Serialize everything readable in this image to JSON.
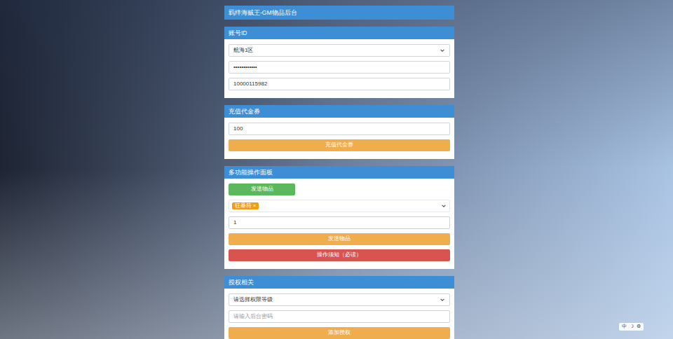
{
  "window": {
    "title": "羁绊海贼王-GM物品后台"
  },
  "sections": [
    {
      "title": "账号ID",
      "fields": [
        {
          "kind": "select",
          "text": "航海1区",
          "placeholder": false
        },
        {
          "kind": "input",
          "text": "••••••••••••",
          "placeholder": false
        },
        {
          "kind": "input",
          "text": "10000115982",
          "placeholder": false
        }
      ]
    },
    {
      "title": "充值代金券",
      "fields": [
        {
          "kind": "input",
          "text": "100",
          "placeholder": false
        },
        {
          "kind": "button",
          "text": "充值代金券",
          "color": "#f0ad4e"
        }
      ]
    },
    {
      "title": "多功能操作面板",
      "fields": [
        {
          "kind": "smallbutton",
          "text": "发送物品",
          "color": "#5cb85c"
        },
        {
          "kind": "tags",
          "tags": [
            {
              "label": "狂暴符",
              "remove": "×"
            }
          ]
        },
        {
          "kind": "input",
          "text": "1",
          "placeholder": false
        },
        {
          "kind": "button",
          "text": "发送物品",
          "color": "#f0ad4e"
        },
        {
          "kind": "button",
          "text": "操作须知（必读）",
          "color": "#d9534f"
        }
      ]
    },
    {
      "title": "授权相关",
      "fields": [
        {
          "kind": "select",
          "text": "请选择权限等级",
          "placeholder": false
        },
        {
          "kind": "input",
          "text": "请输入后台密码",
          "placeholder": true
        },
        {
          "kind": "button",
          "text": "添加授权",
          "color": "#f0ad4e"
        }
      ]
    }
  ],
  "widget": [
    "中",
    "☽",
    "⚙"
  ]
}
